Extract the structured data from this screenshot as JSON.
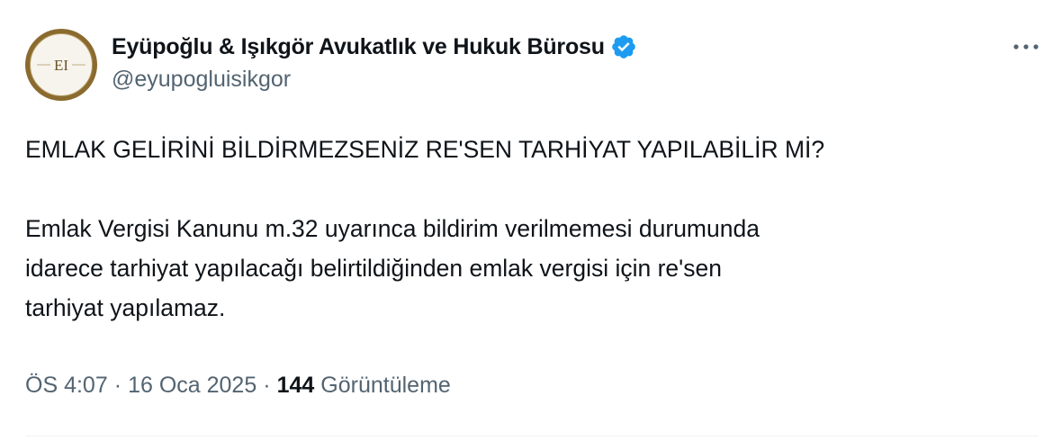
{
  "author": {
    "display_name": "Eyüpoğlu & Işıkgör Avukatlık ve Hukuk Bürosu",
    "handle": "@eyupogluisikgor",
    "avatar_monogram": "EI",
    "verified": true,
    "verified_color": "#1d9bf0"
  },
  "tweet": {
    "headline": "EMLAK GELİRİNİ BİLDİRMEZSENİZ RE'SEN TARHİYAT YAPILABİLİR Mİ?",
    "body": "Emlak Vergisi Kanunu m.32 uyarınca bildirim verilmemesi durumunda\nidarece tarhiyat yapılacağı belirtildiğinden emlak vergisi için re'sen\ntarhiyat yapılamaz."
  },
  "meta": {
    "time": "ÖS 4:07",
    "separator": "·",
    "date": "16 Oca 2025",
    "views_count": "144",
    "views_label": "Görüntüleme"
  },
  "icons": {
    "verified": "verified-badge-icon",
    "more": "more-horizontal-icon"
  },
  "colors": {
    "text_primary": "#0f1419",
    "text_secondary": "#536471",
    "accent": "#1d9bf0",
    "avatar_ring": "#8a6a2e"
  }
}
